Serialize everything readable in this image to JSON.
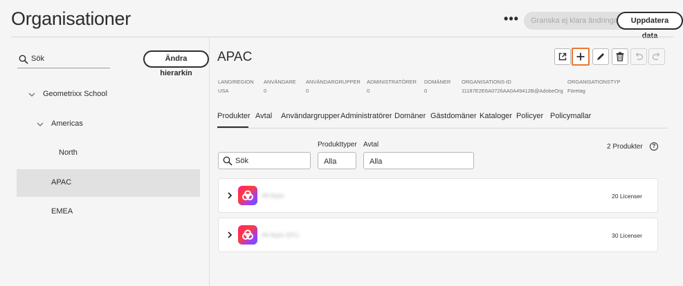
{
  "header": {
    "title": "Organisationer",
    "more_label": "•••",
    "review_label": "Granska ej klara ändringar",
    "update_label": "Uppdatera data"
  },
  "left": {
    "search_placeholder": "Sök",
    "hierarchy_label": "Ändra hierarkin",
    "tree": [
      {
        "label": "Geometrixx School",
        "expanded": true,
        "selected": false
      },
      {
        "label": "Americas",
        "expanded": true,
        "selected": false
      },
      {
        "label": "North",
        "expanded": false,
        "selected": false
      },
      {
        "label": "APAC",
        "expanded": false,
        "selected": true
      },
      {
        "label": "EMEA",
        "expanded": false,
        "selected": false
      }
    ]
  },
  "org": {
    "title": "APAC",
    "meta": [
      {
        "key": "LAND/REGION",
        "value": "USA"
      },
      {
        "key": "ANVÄNDARE",
        "value": "0"
      },
      {
        "key": "ANVÄNDARGRUPPER",
        "value": "0"
      },
      {
        "key": "ADMINISTRATÖRER",
        "value": "0"
      },
      {
        "key": "DOMÄNER",
        "value": "0"
      },
      {
        "key": "ORGANISATIONS-ID",
        "value": "11187E2E6A0726AA0A49412B@AdobeOrg"
      },
      {
        "key": "ORGANISATIONSTYP",
        "value": "Företag"
      }
    ],
    "toolbar": [
      "open-external-icon",
      "add-icon",
      "edit-icon",
      "delete-icon",
      "undo-icon",
      "redo-icon"
    ]
  },
  "tabs": [
    "Produkter",
    "Avtal",
    "Användargrupper",
    "Administratörer",
    "Domäner",
    "Gästdomäner",
    "Kataloger",
    "Policyer",
    "Policymallar"
  ],
  "filters": {
    "search_placeholder": "Sök",
    "product_types_label": "Produkttyper",
    "product_types_value": "Alla",
    "contract_label": "Avtal",
    "contract_value": "Alla"
  },
  "products": {
    "count_label": "2 Produkter",
    "help_glyph": "?",
    "items": [
      {
        "name": "All Apps",
        "licenses": "20 Licenser"
      },
      {
        "name": "All Apps (DC)",
        "licenses": "30 Licenser"
      }
    ]
  },
  "colors": {
    "accent_highlight": "#e9772f",
    "text": "#2c2c2c",
    "selected_bg": "#e1e1e1"
  }
}
